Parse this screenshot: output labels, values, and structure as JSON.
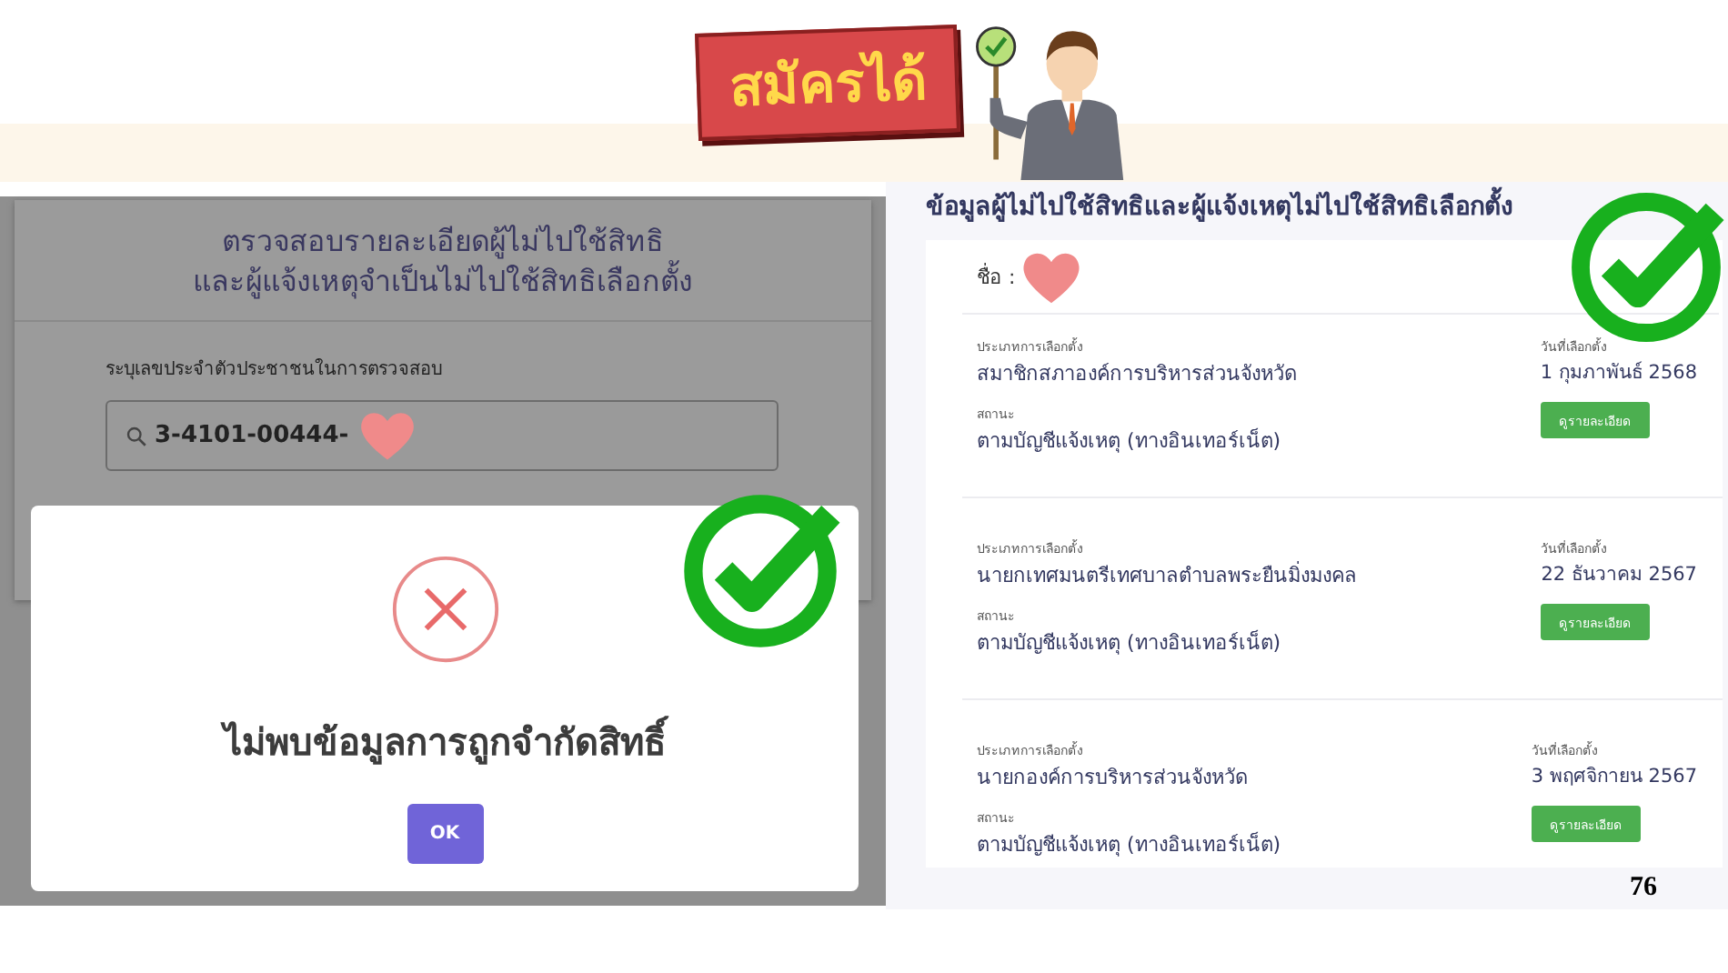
{
  "banner": {
    "title": "สมัครได้"
  },
  "search_screen": {
    "title_lines": [
      "ตรวจสอบรายละเอียดผู้ไม่ไปใช้สิทธิ",
      "และผู้แจ้งเหตุจำเป็นไม่ไปใช้สิทธิเลือกตั้ง"
    ],
    "field_label": "ระบุเลขประจำตัวประชาชนในการตรวจสอบ",
    "field_value": "3-4101-00444-"
  },
  "dialog": {
    "message": "ไม่พบข้อมูลการถูกจำกัดสิทธิ์",
    "button": "OK"
  },
  "results": {
    "title": "ข้อมูลผู้ไม่ไปใช้สิทธิและผู้แจ้งเหตุไม่ไปใช้สิทธิเลือกตั้ง",
    "name_label": "ชื่อ :",
    "records": [
      {
        "type_label": "ประเภทการเลือกตั้ง",
        "type": "สมาชิกสภาองค์การบริหารส่วนจังหวัด",
        "date_label": "วันที่เลือกตั้ง",
        "date": "1 กุมภาพันธ์ 2568",
        "status_label": "สถานะ",
        "status": "ตามบัญชีแจ้งเหตุ (ทางอินเทอร์เน็ต)",
        "button": "ดูรายละเอียด"
      },
      {
        "type_label": "ประเภทการเลือกตั้ง",
        "type": "นายกเทศมนตรีเทศบาลตำบลพระยืนมิ่งมงคล",
        "date_label": "วันที่เลือกตั้ง",
        "date": "22 ธันวาคม 2567",
        "status_label": "สถานะ",
        "status": "ตามบัญชีแจ้งเหตุ (ทางอินเทอร์เน็ต)",
        "button": "ดูรายละเอียด"
      },
      {
        "type_label": "ประเภทการเลือกตั้ง",
        "type": "นายกองค์การบริหารส่วนจังหวัด",
        "date_label": "วันที่เลือกตั้ง",
        "date": "3 พฤศจิกายน 2567",
        "status_label": "สถานะ",
        "status": "ตามบัญชีแจ้งเหตุ (ทางอินเทอร์เน็ต)",
        "button": "ดูรายละเอียด"
      }
    ]
  },
  "page_number": "76"
}
